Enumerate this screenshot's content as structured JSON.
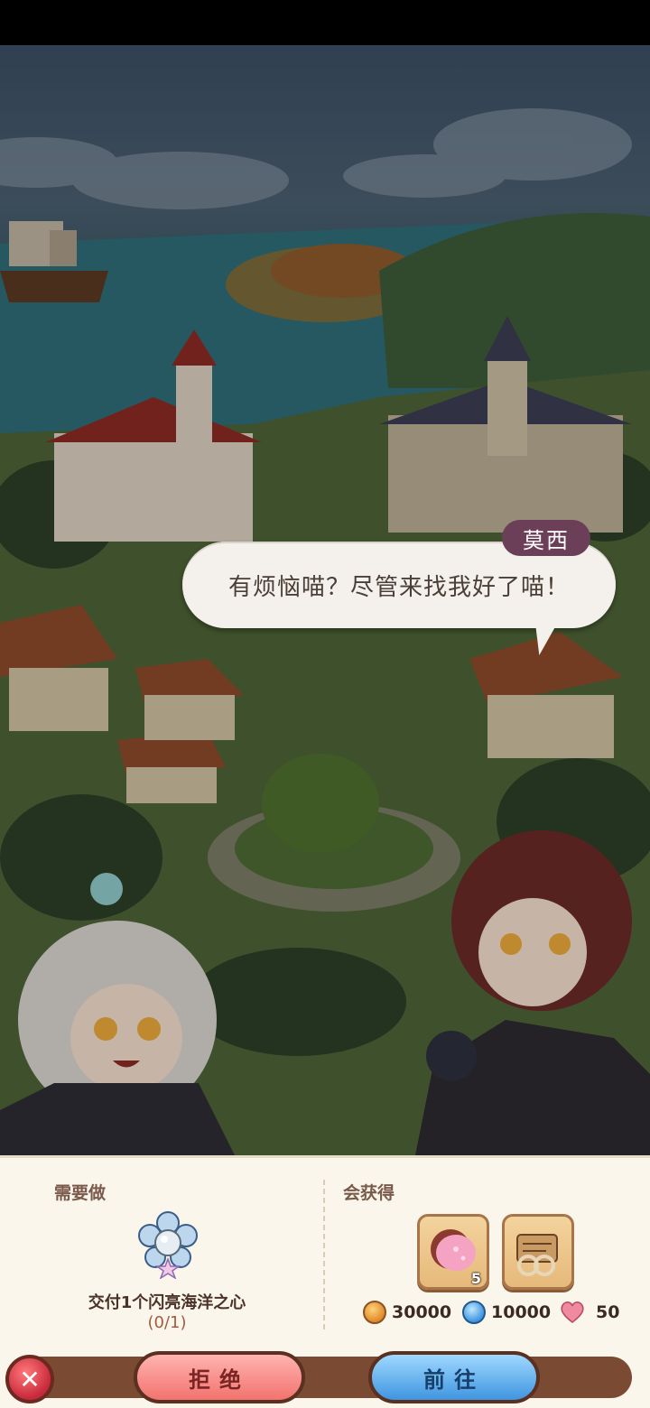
{
  "dialog": {
    "speaker": "莫西",
    "text": "有烦恼喵？尽管来找我好了喵！"
  },
  "quest": {
    "todo_title": "需要做",
    "reward_title": "会获得",
    "task_text": "交付1个闪亮海洋之心",
    "progress": "(0/1)",
    "task_icon": "ocean-heart-pearl-icon"
  },
  "rewards": {
    "items": [
      {
        "icon": "macaron-icon",
        "count": "5"
      },
      {
        "icon": "scroll-map-icon",
        "count": ""
      }
    ],
    "currencies": [
      {
        "icon": "gold-coin-icon",
        "value": "30000",
        "color": "#f0a94a"
      },
      {
        "icon": "blue-gem-icon",
        "value": "10000",
        "color": "#4aa6e6"
      },
      {
        "icon": "heart-icon",
        "value": "50",
        "color": "#f08aa0"
      }
    ]
  },
  "buttons": {
    "close": "✕",
    "refuse": "拒绝",
    "go": "前往"
  }
}
